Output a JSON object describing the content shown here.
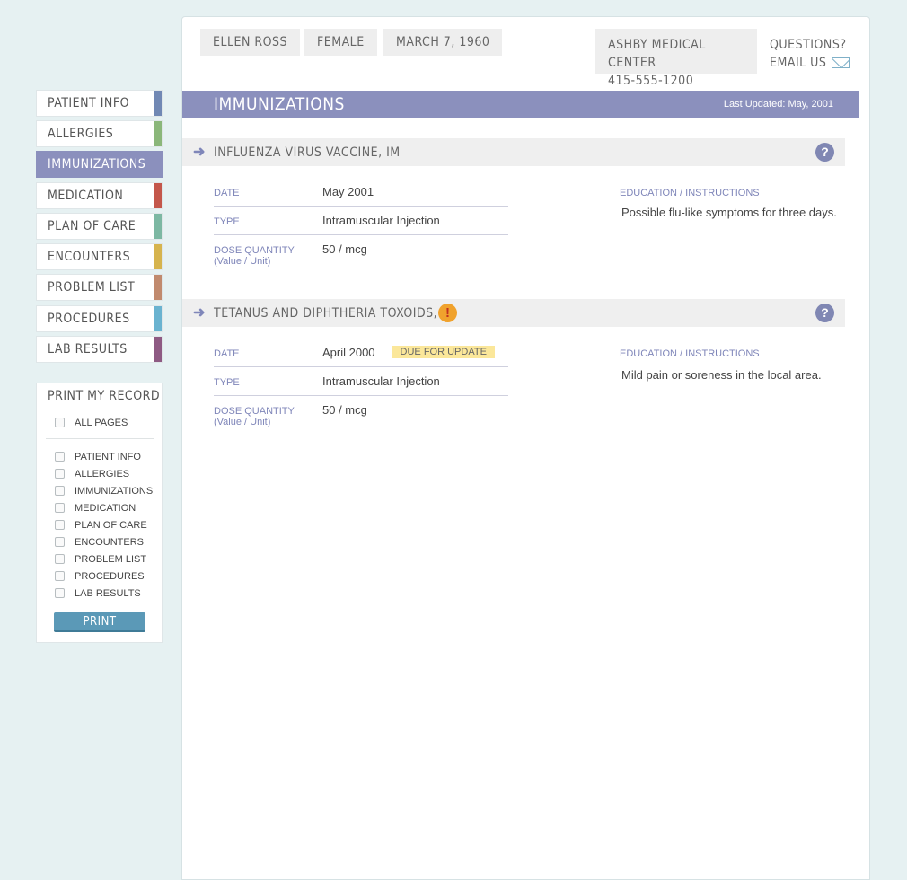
{
  "header": {
    "patient_name": "ELLEN ROSS",
    "gender": "FEMALE",
    "dob": "MARCH 7, 1960",
    "center_name": "ASHBY MEDICAL CENTER",
    "center_phone": "415-555-1200",
    "questions": "QUESTIONS?",
    "email_us": "EMAIL US"
  },
  "section": {
    "title": "IMMUNIZATIONS",
    "last_updated": "Last Updated: May, 2001"
  },
  "labels": {
    "date": "DATE",
    "type": "TYPE",
    "dose": "DOSE QUANTITY",
    "dose_sub": "(Value / Unit)",
    "education": "EDUCATION / INSTRUCTIONS"
  },
  "immunizations": [
    {
      "name": "INFLUENZA VIRUS VACCINE, IM",
      "date": "May 2001",
      "type": "Intramuscular Injection",
      "dose": "50 / mcg",
      "education": "Possible flu-like symptoms for three days."
    },
    {
      "name": "TETANUS AND DIPHTHERIA TOXOIDS, IM",
      "date": "April 2000",
      "badge": "DUE FOR UPDATE",
      "type": "Intramuscular Injection",
      "dose": "50 / mcg",
      "education": "Mild pain or soreness in the local area."
    }
  ],
  "sidebar": {
    "items": [
      {
        "label": "PATIENT INFO",
        "color": "#7188b4"
      },
      {
        "label": "ALLERGIES",
        "color": "#8bb77a"
      },
      {
        "label": "IMMUNIZATIONS",
        "color": "#8b90bd",
        "active": true
      },
      {
        "label": "MEDICATION",
        "color": "#c4574b"
      },
      {
        "label": "PLAN OF CARE",
        "color": "#7db8a3"
      },
      {
        "label": "ENCOUNTERS",
        "color": "#d6b44e"
      },
      {
        "label": "PROBLEM LIST",
        "color": "#c18a6e"
      },
      {
        "label": "PROCEDURES",
        "color": "#6ab3d0"
      },
      {
        "label": "LAB RESULTS",
        "color": "#8e5a83"
      }
    ]
  },
  "print": {
    "title": "PRINT MY RECORD",
    "all_pages": "ALL PAGES",
    "options": [
      "PATIENT INFO",
      "ALLERGIES",
      "IMMUNIZATIONS",
      "MEDICATION",
      "PLAN OF CARE",
      "ENCOUNTERS",
      "PROBLEM LIST",
      "PROCEDURES",
      "LAB RESULTS"
    ],
    "button": "PRINT"
  },
  "icons": {
    "arrow": "arrow-right-icon",
    "help": "help-icon",
    "warning": "warning-icon",
    "mail": "mail-icon"
  }
}
